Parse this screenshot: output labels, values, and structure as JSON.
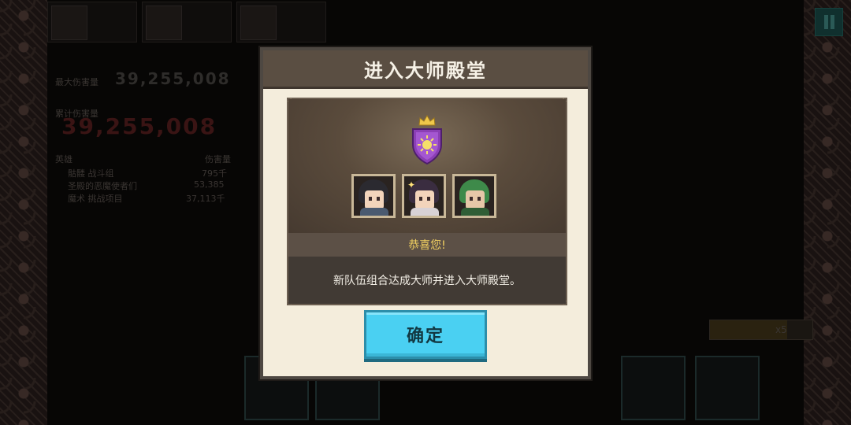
{
  "background": {
    "score_label": "最大伤害量",
    "score_value": "39,255,008",
    "total_label": "累计伤害量",
    "total_value": "39,255,008",
    "stats_header_left": "英雄",
    "stats_header_right": "伤害量",
    "stats_rows": [
      {
        "name": "骷髅 战斗组",
        "value": "795千"
      },
      {
        "name": "圣殿的恶魔使者们",
        "value": "53,385"
      },
      {
        "name": "魔术 挑战项目",
        "value": "37,113千"
      }
    ],
    "multiplier": "x5"
  },
  "modal": {
    "title": "进入大师殿堂",
    "congrats": "恭喜您!",
    "message": "新队伍组合达成大师并进入大师殿堂。",
    "confirm_label": "确定"
  },
  "colors": {
    "header": "#5a4e42",
    "modal_bg": "#f4eddc",
    "panel": "#4b4036",
    "congrats_text": "#f0cf60",
    "button": "#4ad0f2",
    "shield": "#8b3fb5"
  },
  "icons": [
    "crown-icon",
    "shield-emblem-icon",
    "pause-icon",
    "sparkle-icon"
  ]
}
